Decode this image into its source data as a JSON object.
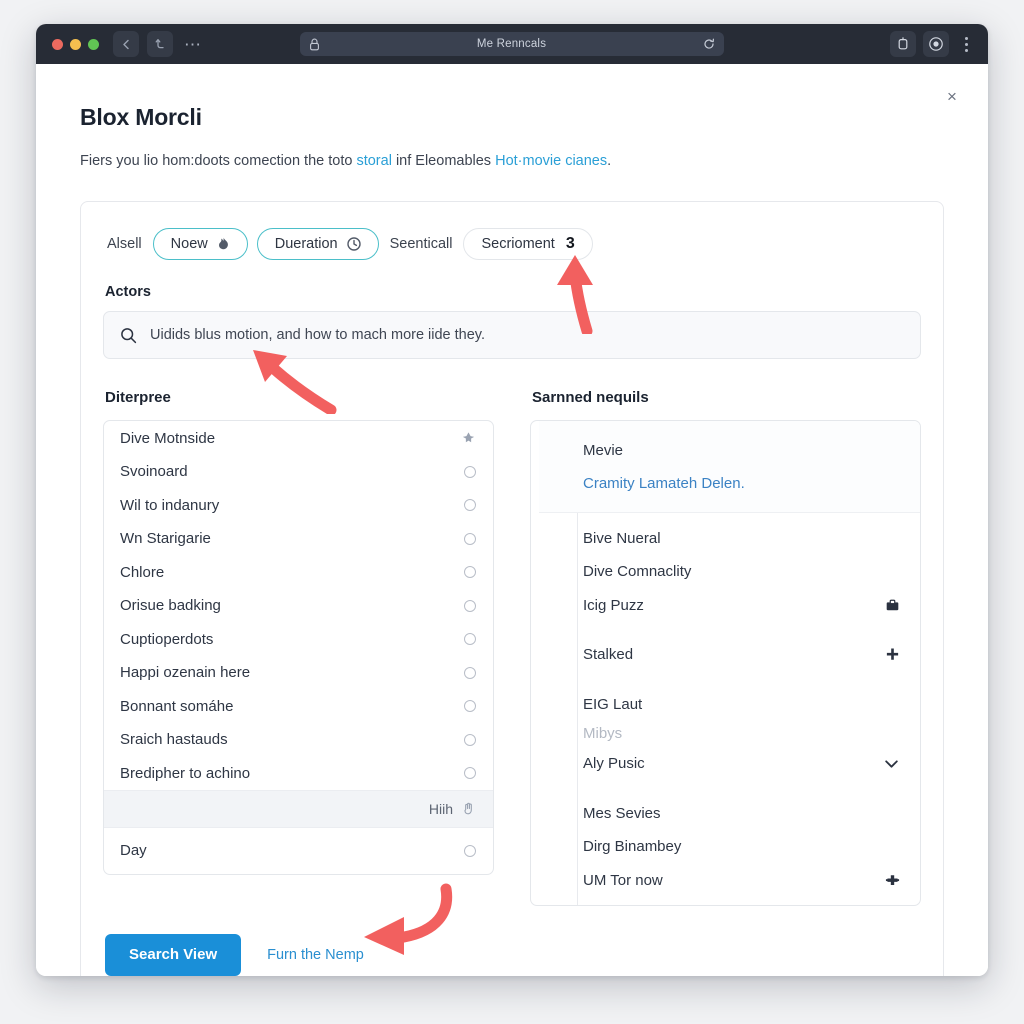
{
  "browser": {
    "url_title": "Me Renncals",
    "icons": {
      "back": "back-chevron-icon",
      "forward": "forward-icon",
      "more": "ellipsis-icon",
      "lock": "lock-icon",
      "reload": "reload-icon",
      "bookmark": "bookmark-icon",
      "profile": "profile-icon",
      "menu": "kebab-menu-icon"
    }
  },
  "modal": {
    "title": "Blox Morcli",
    "close_label": "×",
    "description": {
      "part1": "Fiers you lio hom:doots comection the toto ",
      "link1": "storal",
      "part2": " inf Eleomables ",
      "link2": "Hot·movie cianes",
      "part3": "."
    }
  },
  "filters": {
    "leading_label": "Alsell",
    "middle_label": "Seenticall",
    "pills": [
      {
        "label": "Noew",
        "icon": "flame-icon",
        "active": true
      },
      {
        "label": "Dueration",
        "icon": "clock-icon",
        "active": true
      }
    ],
    "count_pill": {
      "label": "Secrioment",
      "badge": "3"
    }
  },
  "search": {
    "label": "Actors",
    "icon": "search-icon",
    "value": "Uidids blus motion, and how to mach more iide they."
  },
  "left_column": {
    "title": "Diterpree",
    "items": [
      {
        "label": "Dive Motnside",
        "mark": "selected-arrow-icon"
      },
      {
        "label": "Svoinoard",
        "mark": "radio"
      },
      {
        "label": "Wil to indanury",
        "mark": "radio"
      },
      {
        "label": "Wn Starigarie",
        "mark": "radio"
      },
      {
        "label": "Chlore",
        "mark": "radio"
      },
      {
        "label": "Orisue badking",
        "mark": "radio"
      },
      {
        "label": "Cuptioperdots",
        "mark": "radio"
      },
      {
        "label": "Happi ozenain here",
        "mark": "radio"
      },
      {
        "label": "Bonnant somáhe",
        "mark": "radio"
      },
      {
        "label": "Sraich hastauds",
        "mark": "radio"
      },
      {
        "label": "Bredipher to achino",
        "mark": "radio"
      }
    ],
    "hint_row": {
      "label": "Hiih",
      "icon": "hand-icon"
    },
    "footer_item": {
      "label": "Day",
      "mark": "radio"
    }
  },
  "right_column": {
    "title": "Sarnned nequils",
    "groups": [
      {
        "highlight": true,
        "items": [
          {
            "label": "Mevie",
            "style": "normal",
            "icon": ""
          },
          {
            "label": "Cramity Lamateh Delen.",
            "style": "link",
            "icon": ""
          }
        ]
      },
      {
        "highlight": false,
        "items": [
          {
            "label": "Bive Nueral",
            "style": "normal",
            "icon": ""
          },
          {
            "label": "Dive Comnaclity",
            "style": "normal",
            "icon": ""
          },
          {
            "label": "Icig Puzz",
            "style": "normal",
            "icon": "briefcase-icon"
          }
        ]
      },
      {
        "highlight": false,
        "items": [
          {
            "label": "Stalked",
            "style": "normal",
            "icon": "plus-cross-icon"
          }
        ]
      },
      {
        "highlight": false,
        "items": [
          {
            "label": "EIG Laut",
            "style": "normal",
            "icon": ""
          },
          {
            "label": "Mibys",
            "style": "muted",
            "icon": ""
          },
          {
            "label": "Aly Pusic",
            "style": "normal",
            "icon": "chevron-down-icon"
          }
        ]
      },
      {
        "highlight": false,
        "items": [
          {
            "label": "Mes Sevies",
            "style": "normal",
            "icon": ""
          },
          {
            "label": "Dirg Binambey",
            "style": "normal",
            "icon": ""
          },
          {
            "label": "UM Tor now",
            "style": "normal",
            "icon": "puzzle-cross-icon"
          }
        ]
      }
    ]
  },
  "actions": {
    "primary_label": "Search View",
    "secondary_label": "Furn the Nemp"
  },
  "colors": {
    "accent_blue": "#1a8fd8",
    "link_blue": "#2a9fd6",
    "pill_border_active": "#4bbfc9",
    "arrow_red": "#f2605f",
    "titlebar": "#272c36"
  }
}
